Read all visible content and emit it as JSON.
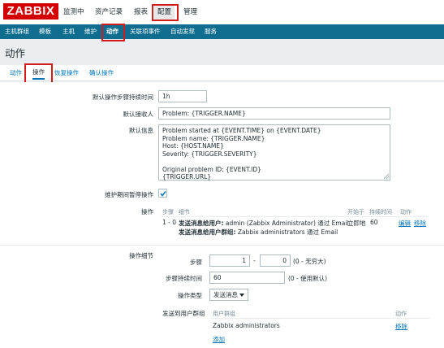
{
  "logo": "ZABBIX",
  "top_menu": [
    {
      "label": "监测中"
    },
    {
      "label": "资产记录"
    },
    {
      "label": "报表"
    },
    {
      "label": "配置"
    },
    {
      "label": "管理"
    }
  ],
  "sub_menu": [
    {
      "label": "主机群组"
    },
    {
      "label": "模板"
    },
    {
      "label": "主机"
    },
    {
      "label": "维护"
    },
    {
      "label": "动作"
    },
    {
      "label": "关联项事件"
    },
    {
      "label": "自动发现"
    },
    {
      "label": "服务"
    }
  ],
  "page_title": "动作",
  "tabs": [
    {
      "label": "动作"
    },
    {
      "label": "操作"
    },
    {
      "label": "恢复操作"
    },
    {
      "label": "确认操作"
    }
  ],
  "form": {
    "default_duration_label": "默认操作步骤持续时间",
    "default_duration_value": "1h",
    "default_subject_label": "默认接收人",
    "default_subject_value": "Problem: {TRIGGER.NAME}",
    "default_message_label": "默认信息",
    "default_message_lines": [
      "Problem started at {EVENT.TIME} on {EVENT.DATE}",
      "Problem name: {TRIGGER.NAME}",
      "Host: {HOST.NAME}",
      "Severity: {TRIGGER.SEVERITY}",
      "",
      "Original problem ID: {EVENT.ID}",
      "{TRIGGER.URL}"
    ],
    "pause_label": "维护期间暂停操作",
    "pause_checked": true,
    "operations_label": "操作",
    "operations_headers": {
      "steps": "步骤",
      "details": "细节",
      "start_in": "开始于",
      "duration": "持续时间",
      "action": "动作"
    },
    "operations_row": {
      "steps": "1 - 0",
      "detail1_prefix": "发送消息给用户:",
      "detail1_rest": " admin (Zabbix Administrator) 通过 Email",
      "detail2_prefix": "发送消息给用户群组:",
      "detail2_rest": " Zabbix administrators 通过 Email",
      "start_in": "立即地",
      "duration": "60",
      "edit": "编辑",
      "remove": "移除"
    },
    "op_details_label": "操作细节",
    "steps_label": "步骤",
    "steps_from": "1",
    "steps_dash": "-",
    "steps_to": "0",
    "steps_hint": "(0 - 无穷大)",
    "step_duration_label": "步骤持续时间",
    "step_duration_value": "60",
    "step_duration_hint": "(0 - 使用默认)",
    "op_type_label": "操作类型",
    "op_type_value": "发送消息",
    "send_to_groups_label": "发送到用户群组",
    "groups_header_group": "用户群组",
    "groups_header_action": "动作",
    "group_row_name": "Zabbix administrators",
    "group_row_remove": "移除",
    "group_add": "添加"
  }
}
